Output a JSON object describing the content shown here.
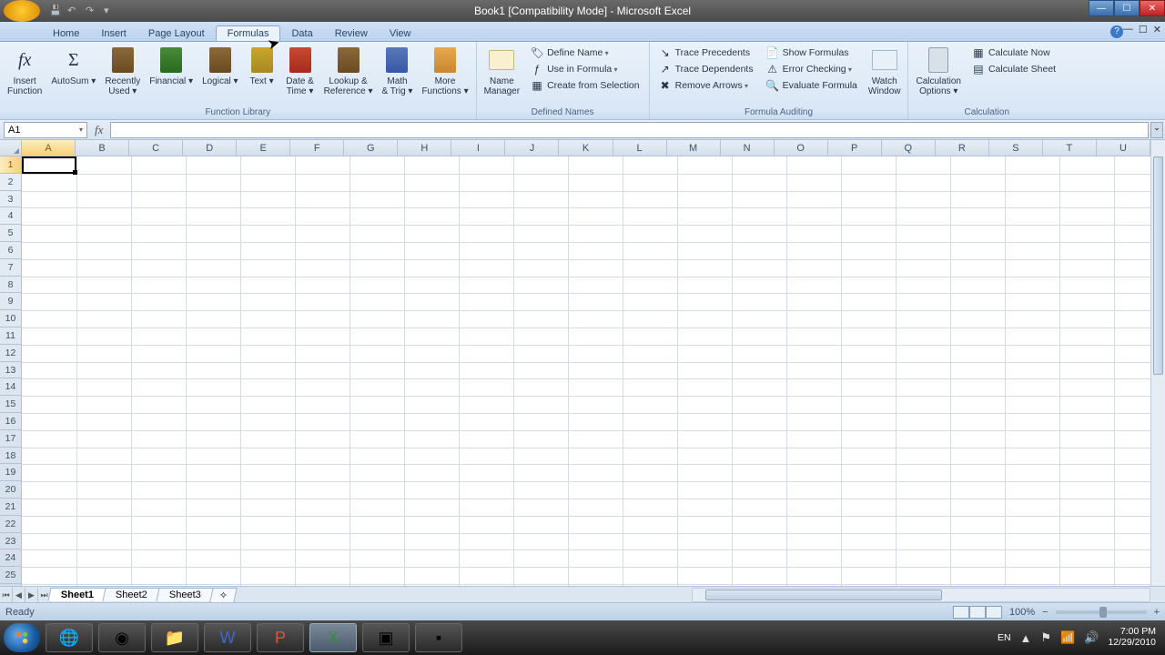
{
  "titlebar": {
    "title": "Book1 [Compatibility Mode] - Microsoft Excel"
  },
  "tabs": {
    "items": [
      "Home",
      "Insert",
      "Page Layout",
      "Formulas",
      "Data",
      "Review",
      "View"
    ],
    "active_index": 3
  },
  "ribbon": {
    "group_function_library": {
      "label": "Function Library",
      "insert_function": "Insert\nFunction",
      "autosum": "AutoSum",
      "recently_used": "Recently\nUsed",
      "financial": "Financial",
      "logical": "Logical",
      "text": "Text",
      "date_time": "Date &\nTime",
      "lookup_ref": "Lookup &\nReference",
      "math_trig": "Math\n& Trig",
      "more_functions": "More\nFunctions"
    },
    "group_defined_names": {
      "label": "Defined Names",
      "name_manager": "Name\nManager",
      "define_name": "Define Name",
      "use_in_formula": "Use in Formula",
      "create_from_selection": "Create from Selection"
    },
    "group_formula_auditing": {
      "label": "Formula Auditing",
      "trace_precedents": "Trace Precedents",
      "trace_dependents": "Trace Dependents",
      "remove_arrows": "Remove Arrows",
      "show_formulas": "Show Formulas",
      "error_checking": "Error Checking",
      "evaluate_formula": "Evaluate Formula",
      "watch_window": "Watch\nWindow"
    },
    "group_calculation": {
      "label": "Calculation",
      "calculation_options": "Calculation\nOptions",
      "calculate_now": "Calculate Now",
      "calculate_sheet": "Calculate Sheet"
    }
  },
  "formula_bar": {
    "name_box": "A1",
    "formula": ""
  },
  "grid": {
    "columns": [
      "A",
      "B",
      "C",
      "D",
      "E",
      "F",
      "G",
      "H",
      "I",
      "J",
      "K",
      "L",
      "M",
      "N",
      "O",
      "P",
      "Q",
      "R",
      "S",
      "T",
      "U"
    ],
    "rows": [
      "1",
      "2",
      "3",
      "4",
      "5",
      "6",
      "7",
      "8",
      "9",
      "10",
      "11",
      "12",
      "13",
      "14",
      "15",
      "16",
      "17",
      "18",
      "19",
      "20",
      "21",
      "22",
      "23",
      "24",
      "25"
    ],
    "active_cell": "A1"
  },
  "sheets": {
    "items": [
      "Sheet1",
      "Sheet2",
      "Sheet3"
    ],
    "active_index": 0
  },
  "statusbar": {
    "left": "Ready",
    "zoom": "100%"
  },
  "taskbar": {
    "lang": "EN",
    "time": "7:00 PM",
    "date": "12/29/2010"
  }
}
